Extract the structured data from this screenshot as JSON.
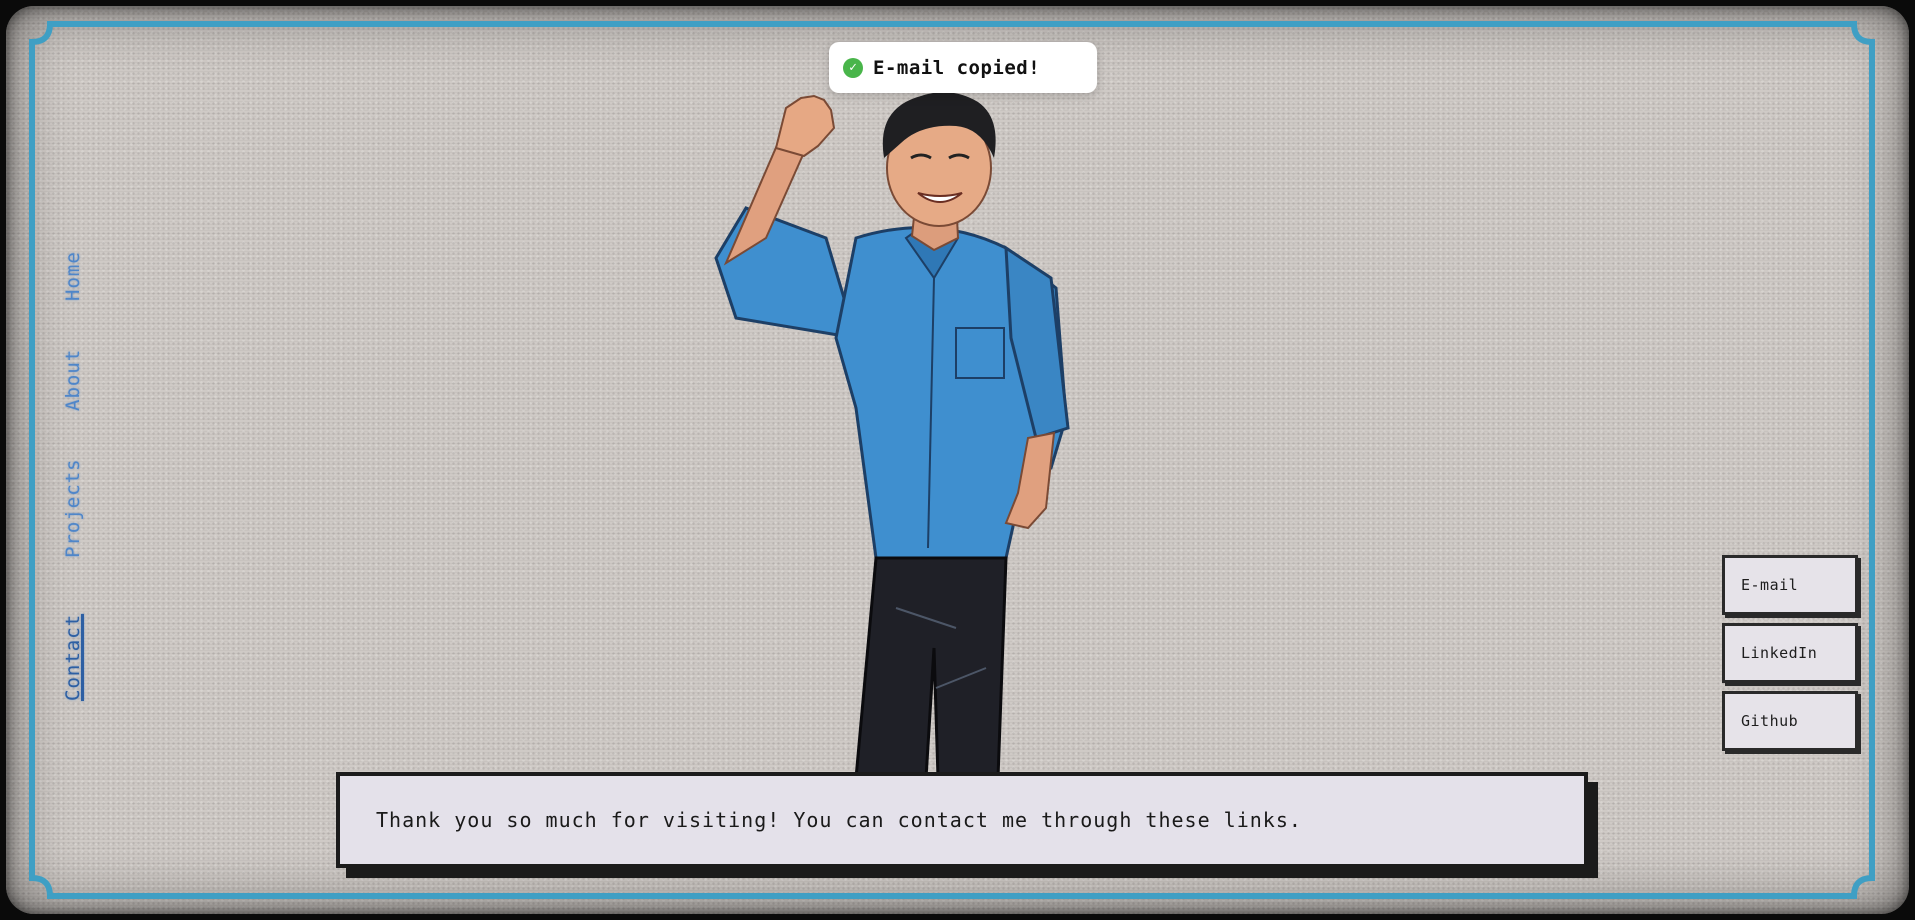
{
  "toast": {
    "icon": "check-circle-icon",
    "message": "E-mail copied!"
  },
  "nav": {
    "items": [
      {
        "label": "Home"
      },
      {
        "label": "About"
      },
      {
        "label": "Projects"
      },
      {
        "label": "Contact",
        "active": true
      }
    ]
  },
  "dialog": {
    "text": "Thank you so much for visiting! You can contact me through these links."
  },
  "links": [
    {
      "label": "E-mail"
    },
    {
      "label": "LinkedIn"
    },
    {
      "label": "Github"
    }
  ],
  "colors": {
    "frame": "#3f9fc4",
    "nav": "#4f86c9",
    "screen_bg": "#cfcac6",
    "toast_check": "#49b54a",
    "shirt": "#3f8fcf"
  }
}
